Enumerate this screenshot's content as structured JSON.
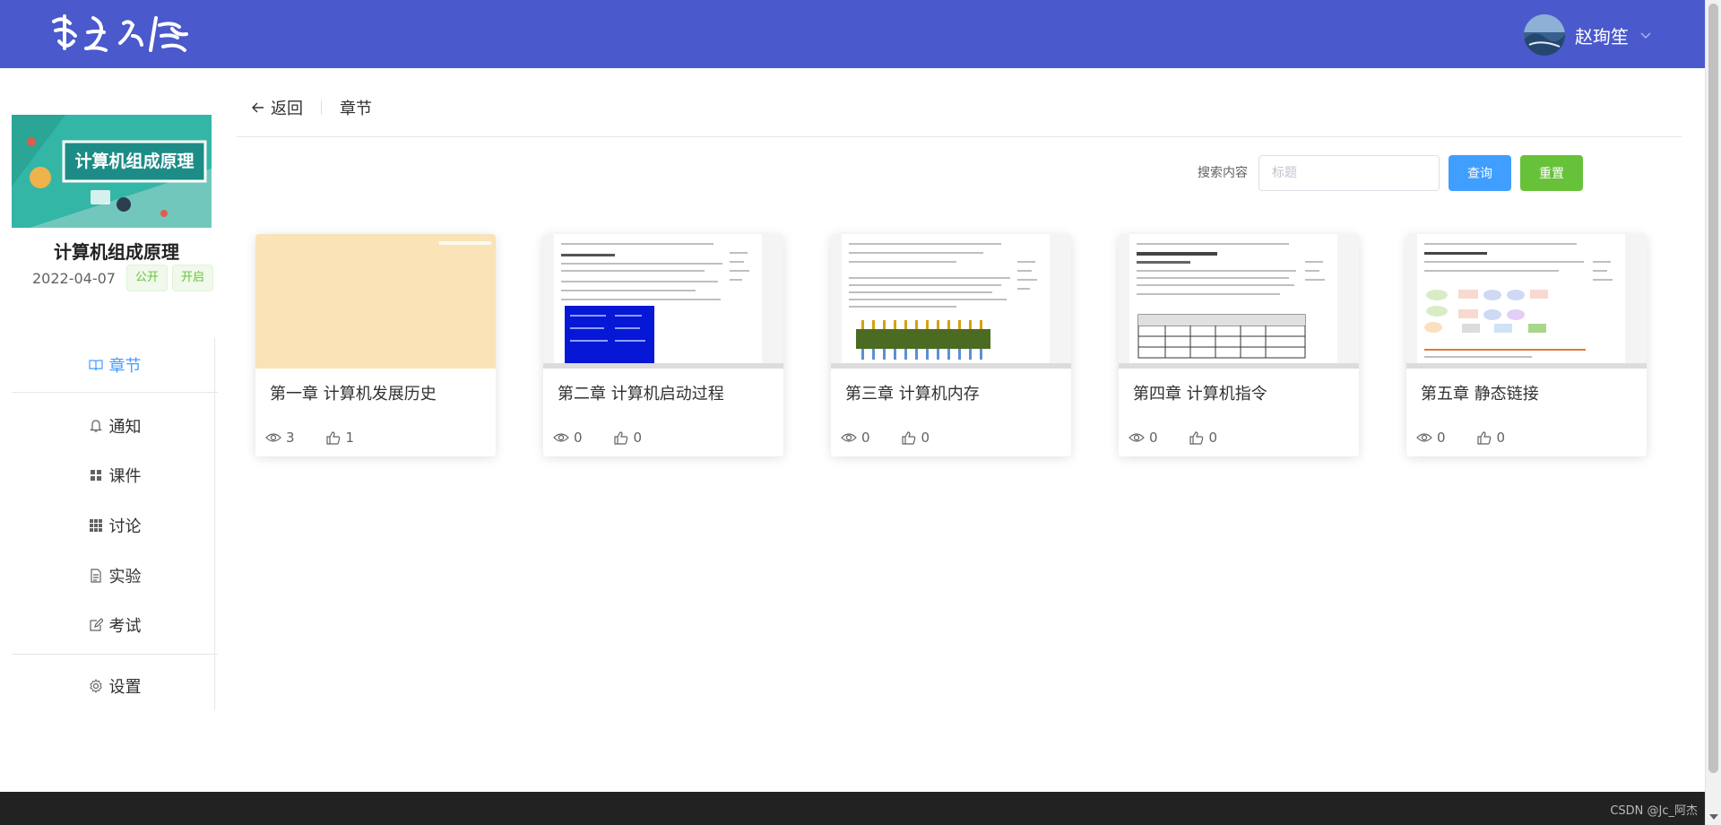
{
  "header": {
    "logo_text": "慧星之友",
    "username": "赵珣笙"
  },
  "sidebar": {
    "course_title": "计算机组成原理",
    "cover_text": "计算机组成原理",
    "date": "2022-04-07",
    "tags": [
      "公开",
      "开启"
    ],
    "menu": [
      {
        "label": "章节",
        "icon": "book-icon",
        "active": true
      },
      {
        "label": "通知",
        "icon": "bell-icon"
      },
      {
        "label": "课件",
        "icon": "grid-icon"
      },
      {
        "label": "讨论",
        "icon": "apps-icon"
      },
      {
        "label": "实验",
        "icon": "document-icon"
      },
      {
        "label": "考试",
        "icon": "edit-icon"
      },
      {
        "label": "设置",
        "icon": "gear-icon"
      }
    ]
  },
  "main": {
    "back_label": "返回",
    "crumb_current": "章节",
    "search": {
      "label": "搜索内容",
      "placeholder": "标题",
      "query_label": "查询",
      "reset_label": "重置"
    },
    "chapters": [
      {
        "title": "第一章 计算机发展历史",
        "views": "3",
        "likes": "1",
        "thumb": "blank"
      },
      {
        "title": "第二章 计算机启动过程",
        "views": "0",
        "likes": "0",
        "thumb": "doc-blue"
      },
      {
        "title": "第三章 计算机内存",
        "views": "0",
        "likes": "0",
        "thumb": "doc-chip"
      },
      {
        "title": "第四章 计算机指令",
        "views": "0",
        "likes": "0",
        "thumb": "doc-table"
      },
      {
        "title": "第五章 静态链接",
        "views": "0",
        "likes": "0",
        "thumb": "doc-flow"
      }
    ]
  },
  "footer": {
    "watermark": "CSDN @Jc_阿杰"
  },
  "colors": {
    "header_bg": "#4a59cb",
    "accent": "#409eff",
    "success": "#67c23a",
    "footer_bg": "#222222"
  }
}
